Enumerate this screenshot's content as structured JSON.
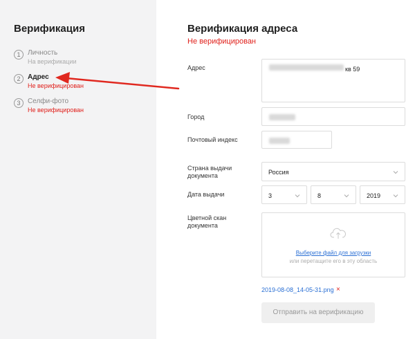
{
  "sidebar": {
    "title": "Верификация",
    "steps": [
      {
        "num": "1",
        "label": "Личность",
        "status": "На верификации"
      },
      {
        "num": "2",
        "label": "Адрес",
        "status": "Не верифицирован"
      },
      {
        "num": "3",
        "label": "Селфи-фото",
        "status": "Не верифицирован"
      }
    ]
  },
  "main": {
    "title": "Верификация адреса",
    "status": "Не верифицирован",
    "fields": {
      "address": {
        "label": "Адрес",
        "value_visible": "кв 59"
      },
      "city": {
        "label": "Город"
      },
      "postal": {
        "label": "Почтовый индекс"
      },
      "country": {
        "label": "Страна выдачи документа",
        "value": "Россия"
      },
      "issue_date": {
        "label": "Дата выдачи",
        "day": "3",
        "month": "8",
        "year": "2019"
      },
      "scan": {
        "label": "Цветной скан документа",
        "link": "Выберите файл для загрузки",
        "hint": "или перетащите его в эту область"
      }
    },
    "attached_file": "2019-08-08_14-05-31.png",
    "remove_icon": "×",
    "submit_label": "Отправить на верификацию"
  },
  "colors": {
    "error": "#e0201b",
    "link": "#2a6fd4",
    "sidebar_bg": "#f3f3f4"
  }
}
